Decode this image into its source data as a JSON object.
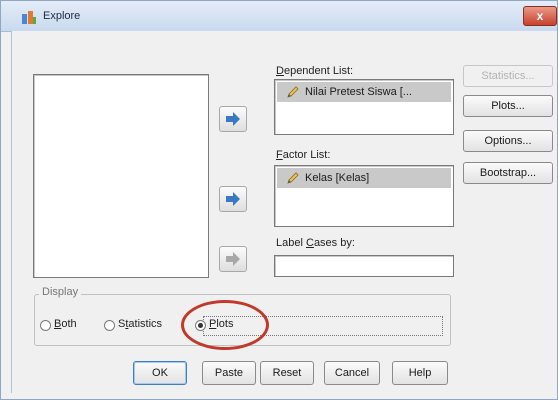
{
  "window": {
    "title": "Explore",
    "close_label": "x"
  },
  "dependent_list": {
    "label_pre": "",
    "label_u": "D",
    "label_post": "ependent List:",
    "items": [
      "Nilai Pretest Siswa [..."
    ]
  },
  "factor_list": {
    "label_pre": "",
    "label_u": "F",
    "label_post": "actor List:",
    "items": [
      "Kelas [Kelas]"
    ]
  },
  "label_cases": {
    "label_pre": "Label ",
    "label_u": "C",
    "label_post": "ases by:",
    "value": ""
  },
  "side_buttons": {
    "statistics": "Statistics...",
    "plots": "Plots...",
    "options": "Options...",
    "bootstrap": "Bootstrap..."
  },
  "display": {
    "label": "Display",
    "options": [
      {
        "pre": "",
        "u": "B",
        "post": "oth",
        "selected": false
      },
      {
        "pre": "S",
        "u": "t",
        "post": "atistics",
        "selected": false
      },
      {
        "pre": "",
        "u": "P",
        "post": "lots",
        "selected": true
      }
    ]
  },
  "bottom_buttons": {
    "ok": "OK",
    "paste": "Paste",
    "reset": "Reset",
    "cancel": "Cancel",
    "help": "Help"
  },
  "colors": {
    "highlight_circle": "#c0392b",
    "arrow_blue": "#3b78c4"
  }
}
